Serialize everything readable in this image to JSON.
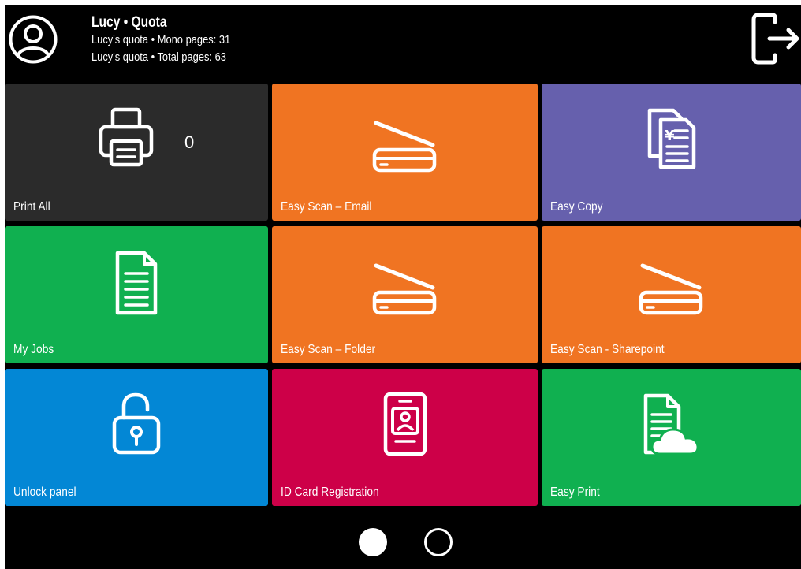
{
  "header": {
    "user_name": "Lucy • Quota",
    "quota_lines": [
      "Lucy's quota • Mono pages: 31",
      "Lucy's quota • Total pages: 63"
    ],
    "avatar_icon": "user-circle-icon",
    "logout_icon": "sign-out-icon"
  },
  "tiles": [
    {
      "label": "Print All",
      "icon": "printer-icon",
      "count": "0",
      "color": "#2b2b2b"
    },
    {
      "label": "Easy Scan – Email",
      "icon": "scanner-icon",
      "color": "#f07422"
    },
    {
      "label": "Easy Copy",
      "icon": "copy-documents-icon",
      "color": "#6660ad"
    },
    {
      "label": "My Jobs",
      "icon": "document-icon",
      "color": "#10b050"
    },
    {
      "label": "Easy Scan – Folder",
      "icon": "scanner-icon",
      "color": "#f07422"
    },
    {
      "label": "Easy Scan - Sharepoint",
      "icon": "scanner-icon",
      "color": "#f07422"
    },
    {
      "label": "Unlock panel",
      "icon": "padlock-open-icon",
      "color": "#0387d5"
    },
    {
      "label": "ID Card Registration",
      "icon": "id-card-icon",
      "color": "#cd0048"
    },
    {
      "label": "Easy Print",
      "icon": "cloud-document-icon",
      "color": "#10b050"
    }
  ],
  "pager": {
    "pages": 2,
    "current": 1
  }
}
